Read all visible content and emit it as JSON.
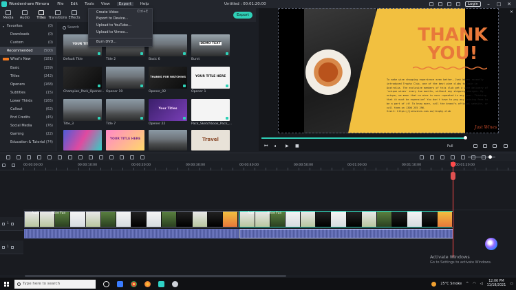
{
  "title_bar": {
    "app_name": "Wondershare Filmora",
    "menu": [
      "File",
      "Edit",
      "Tools",
      "View",
      "Export",
      "Help"
    ],
    "document": "Untitled : 00:01:20:00",
    "login_label": "Login"
  },
  "tabs": [
    {
      "label": "Media",
      "icon": "folder-icon"
    },
    {
      "label": "Audio",
      "icon": "music-icon"
    },
    {
      "label": "Titles",
      "icon": "text-icon"
    },
    {
      "label": "Transitions",
      "icon": "transition-icon"
    },
    {
      "label": "Effects",
      "icon": "effects-icon"
    }
  ],
  "export_button": "Export",
  "export_menu": {
    "items": [
      {
        "label": "Create Video",
        "shortcut": "Ctrl+E"
      },
      {
        "label": "Export to Device...",
        "shortcut": ""
      },
      {
        "label": "Upload to YouTube...",
        "shortcut": ""
      },
      {
        "label": "Upload to Vimeo...",
        "shortcut": ""
      },
      {
        "label": "Burn DVD...",
        "shortcut": ""
      }
    ]
  },
  "sidebar": {
    "items": [
      {
        "label": "Favorites",
        "count": "(0)"
      },
      {
        "label": "Downloads",
        "count": "(0)"
      },
      {
        "label": "Custom",
        "count": "(0)"
      },
      {
        "label": "Recommended",
        "count": "(500)"
      },
      {
        "label": "What's New",
        "count": "(181)"
      },
      {
        "label": "Basic",
        "count": "(159)"
      },
      {
        "label": "Titles",
        "count": "(242)"
      },
      {
        "label": "Openers",
        "count": "(168)"
      },
      {
        "label": "Subtitles",
        "count": "(15)"
      },
      {
        "label": "Lower Thirds",
        "count": "(165)"
      },
      {
        "label": "Callout",
        "count": "(62)"
      },
      {
        "label": "End Credits",
        "count": "(45)"
      },
      {
        "label": "Social Media",
        "count": "(76)"
      },
      {
        "label": "Gaming",
        "count": "(22)"
      },
      {
        "label": "Education & Tutorial",
        "count": "(74)"
      }
    ]
  },
  "search": {
    "label": "Search"
  },
  "thumbnails": [
    {
      "label": "Default Title",
      "text": "YOUR TITLE"
    },
    {
      "label": "Title 2",
      "text": ""
    },
    {
      "label": "Basic 6",
      "text": ""
    },
    {
      "label": "Burst",
      "text": "DEMO TEXT"
    },
    {
      "label": "Champion_Pack_Opener...",
      "text": ""
    },
    {
      "label": "Opener 19",
      "text": ""
    },
    {
      "label": "Opener_02",
      "text": "THANKS FOR WATCHING"
    },
    {
      "label": "Opener 1",
      "text": "YOUR TITLE HERE"
    },
    {
      "label": "Title_3",
      "text": ""
    },
    {
      "label": "Title 7",
      "text": ""
    },
    {
      "label": "Opener 22",
      "text": "Your Titles"
    },
    {
      "label": "Pack_Sketchbook_Pack_...",
      "text": ""
    },
    {
      "label": "",
      "text": ""
    },
    {
      "label": "",
      "text": "YOUR TITLE HERE"
    },
    {
      "label": "",
      "text": ""
    },
    {
      "label": "",
      "text": "Travel"
    }
  ],
  "preview": {
    "heading": "THANK\nYOU!",
    "body": "To make wine shopping experience even better, Just Wines recently introduced Trophy Club, one of the best wine clubs to join in Australia. The exclusive members of this club get a wine delivery of 'unique wines' every two months, without any shipping charges. By unique, we mean that no wine is ever repeated in any year. Thinking that it must be expensive? You don't have to pay any joining fees to be a part of it! To know more, call the brand's official website, or call them on 1300 255 296.",
    "visit": "Visit: https://justwines.com.au/trophy-club",
    "signature": "Just Wines",
    "quality": "Full",
    "progress": 1.0
  },
  "timeline": {
    "ruler": [
      "00:00:00:00",
      "00:00:10:00",
      "00:00:20:00",
      "00:00:30:00",
      "00:00:40:00",
      "00:00:50:00",
      "00:01:00:00",
      "00:01:10:00",
      "00:01:20:00"
    ],
    "clips": [
      {
        "label": "Audi",
        "label2": "Wine Fun"
      },
      {
        "label": "Audi",
        "label2": "Wine Fun"
      }
    ],
    "track_labels": [
      "1",
      "1"
    ]
  },
  "watermark": {
    "title": "Activate Windows",
    "sub": "Go to Settings to activate Windows."
  },
  "taskbar": {
    "search_placeholder": "Type here to search",
    "weather": "25°C  Smoke",
    "time": "12:06 PM",
    "date": "11/18/2021"
  }
}
